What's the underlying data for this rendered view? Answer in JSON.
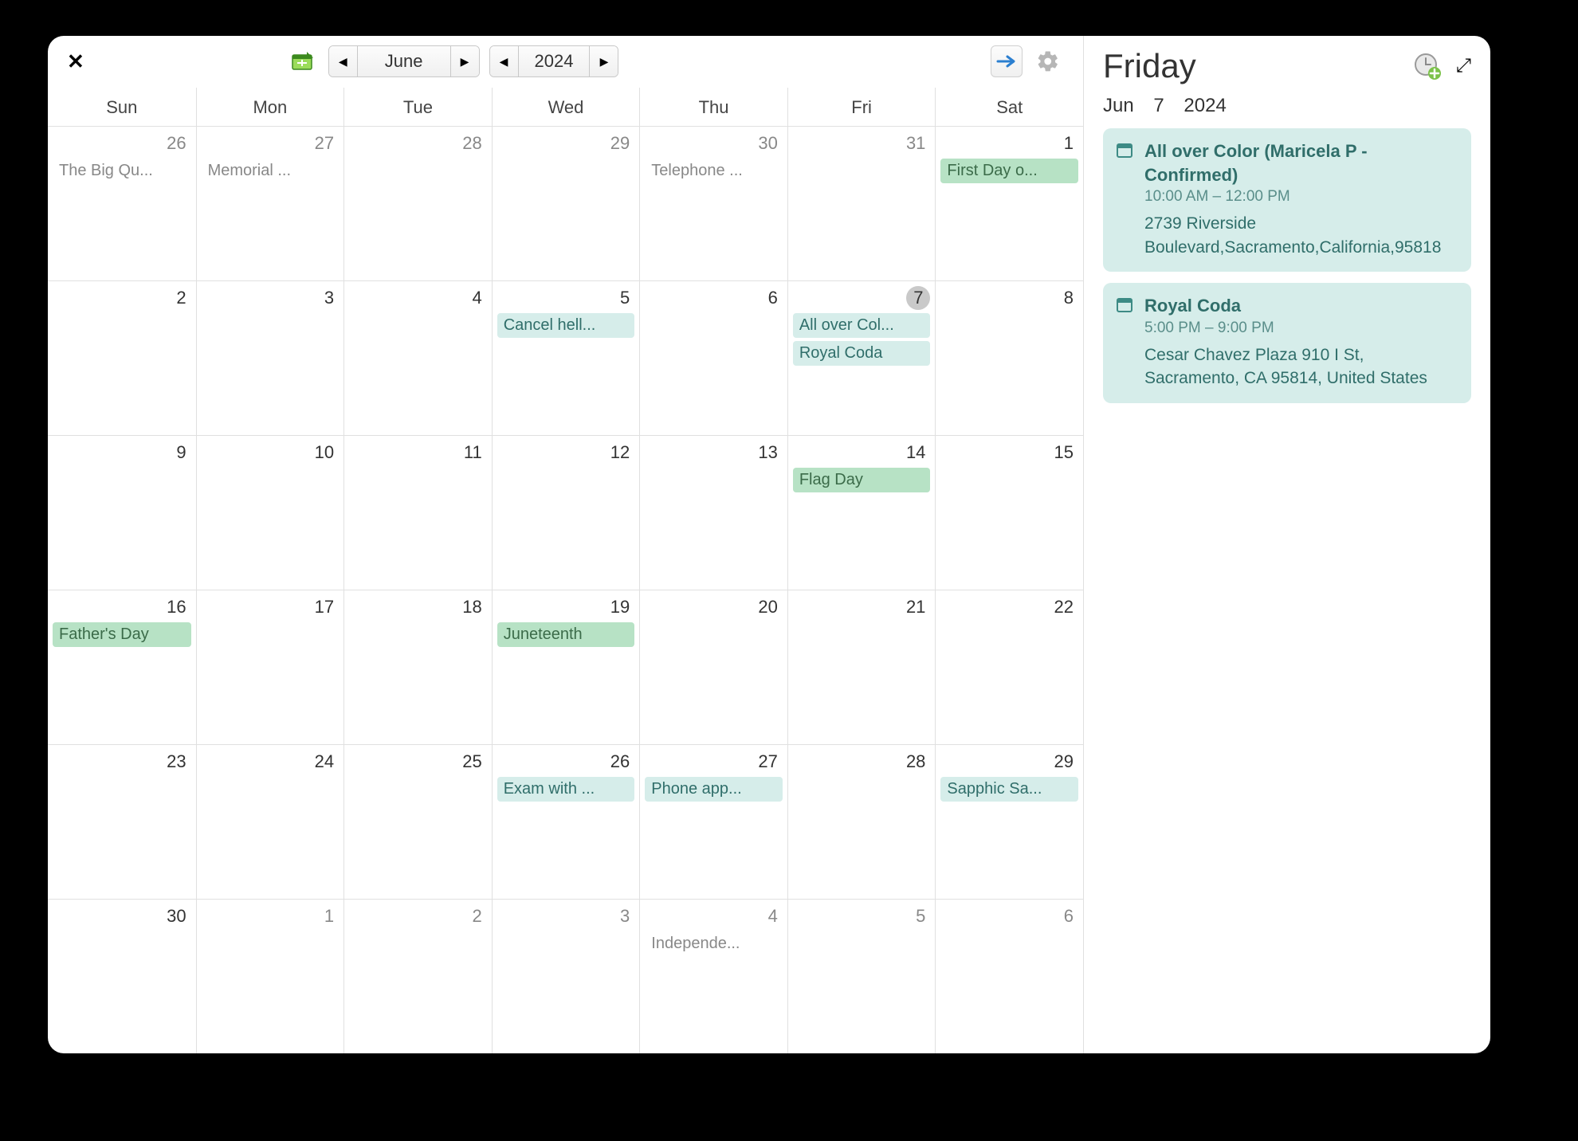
{
  "toolbar": {
    "month_label": "June",
    "year_label": "2024"
  },
  "dow": [
    "Sun",
    "Mon",
    "Tue",
    "Wed",
    "Thu",
    "Fri",
    "Sat"
  ],
  "weeks": [
    [
      {
        "n": "26",
        "other": true,
        "events": [
          {
            "label": "The Big Qu...",
            "style": "plain"
          }
        ]
      },
      {
        "n": "27",
        "other": true,
        "events": [
          {
            "label": "Memorial ...",
            "style": "plain"
          }
        ]
      },
      {
        "n": "28",
        "other": true,
        "events": []
      },
      {
        "n": "29",
        "other": true,
        "events": []
      },
      {
        "n": "30",
        "other": true,
        "events": [
          {
            "label": "Telephone ...",
            "style": "plain"
          }
        ]
      },
      {
        "n": "31",
        "other": true,
        "events": []
      },
      {
        "n": "1",
        "events": [
          {
            "label": "First Day o...",
            "style": "green"
          }
        ]
      }
    ],
    [
      {
        "n": "2",
        "events": []
      },
      {
        "n": "3",
        "events": []
      },
      {
        "n": "4",
        "events": []
      },
      {
        "n": "5",
        "events": [
          {
            "label": "Cancel hell...",
            "style": "teal"
          }
        ]
      },
      {
        "n": "6",
        "events": []
      },
      {
        "n": "7",
        "selected": true,
        "events": [
          {
            "label": "All over Col...",
            "style": "teal"
          },
          {
            "label": "Royal Coda",
            "style": "teal"
          }
        ]
      },
      {
        "n": "8",
        "events": []
      }
    ],
    [
      {
        "n": "9",
        "events": []
      },
      {
        "n": "10",
        "events": []
      },
      {
        "n": "11",
        "events": []
      },
      {
        "n": "12",
        "events": []
      },
      {
        "n": "13",
        "events": []
      },
      {
        "n": "14",
        "events": [
          {
            "label": "Flag Day",
            "style": "green"
          }
        ]
      },
      {
        "n": "15",
        "events": []
      }
    ],
    [
      {
        "n": "16",
        "events": [
          {
            "label": "Father's Day",
            "style": "green"
          }
        ]
      },
      {
        "n": "17",
        "events": []
      },
      {
        "n": "18",
        "events": []
      },
      {
        "n": "19",
        "events": [
          {
            "label": "Juneteenth",
            "style": "green"
          }
        ]
      },
      {
        "n": "20",
        "events": []
      },
      {
        "n": "21",
        "events": []
      },
      {
        "n": "22",
        "events": []
      }
    ],
    [
      {
        "n": "23",
        "events": []
      },
      {
        "n": "24",
        "events": []
      },
      {
        "n": "25",
        "events": []
      },
      {
        "n": "26",
        "events": [
          {
            "label": "Exam with ...",
            "style": "teal"
          }
        ]
      },
      {
        "n": "27",
        "events": [
          {
            "label": "Phone app...",
            "style": "teal"
          }
        ]
      },
      {
        "n": "28",
        "events": []
      },
      {
        "n": "29",
        "events": [
          {
            "label": "Sapphic Sa...",
            "style": "teal"
          }
        ]
      }
    ],
    [
      {
        "n": "30",
        "events": []
      },
      {
        "n": "1",
        "other": true,
        "events": []
      },
      {
        "n": "2",
        "other": true,
        "events": []
      },
      {
        "n": "3",
        "other": true,
        "events": []
      },
      {
        "n": "4",
        "other": true,
        "events": [
          {
            "label": "Independe...",
            "style": "plain"
          }
        ]
      },
      {
        "n": "5",
        "other": true,
        "events": []
      },
      {
        "n": "6",
        "other": true,
        "events": []
      }
    ]
  ],
  "detail": {
    "day_name": "Friday",
    "date_month": "Jun",
    "date_day": "7",
    "date_year": "2024",
    "events": [
      {
        "title": "All over Color (Maricela P - Confirmed)",
        "time": "10:00 AM – 12:00 PM",
        "location": "2739 Riverside Boulevard,Sacramento,California,95818"
      },
      {
        "title": "Royal Coda",
        "time": "5:00 PM – 9:00 PM",
        "location": "Cesar Chavez Plaza\n910 I St, Sacramento, CA  95814, United States"
      }
    ]
  }
}
